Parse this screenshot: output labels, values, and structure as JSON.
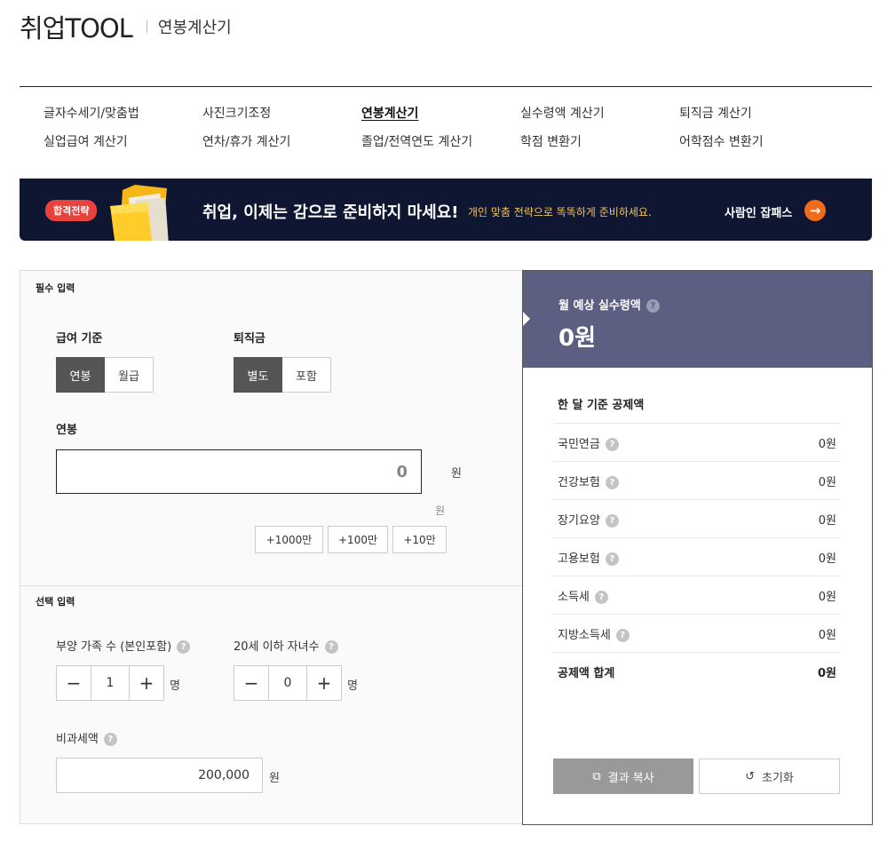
{
  "header": {
    "brand": "취업TOOL",
    "subtitle": "연봉계산기"
  },
  "nav": {
    "row1": [
      "글자수세기/맞춤법",
      "사진크기조정",
      "연봉계산기",
      "실수령액 계산기",
      "퇴직금 계산기"
    ],
    "row2": [
      "실업급여 계산기",
      "연차/휴가 계산기",
      "졸업/전역연도 계산기",
      "학점 변환기",
      "어학점수 변환기"
    ],
    "active": "연봉계산기"
  },
  "banner": {
    "badge": "합격전략",
    "main": "취업, 이제는 감으로 준비하지 마세요!",
    "desc": "개인 맞춤 전략으로 똑똑하게 준비하세요.",
    "cta": "사람인 잡패스",
    "cta_icon": "arrow-right-icon",
    "cta_color": "#f26b1d"
  },
  "required": {
    "title": "필수 입력",
    "pay_basis": {
      "label": "급여 기준",
      "options": [
        "연봉",
        "월급"
      ],
      "selected": "연봉"
    },
    "severance": {
      "label": "퇴직금",
      "options": [
        "별도",
        "포함"
      ],
      "selected": "별도"
    },
    "salary": {
      "label": "연봉",
      "value": "0",
      "unit": "원",
      "sub_unit": "원"
    },
    "add_buttons": [
      "+1000만",
      "+100만",
      "+10만"
    ]
  },
  "optional": {
    "title": "선택 입력",
    "dependents": {
      "label": "부양 가족 수 (본인포함)",
      "value": "1",
      "unit": "명",
      "minus": "−",
      "plus": "+"
    },
    "children": {
      "label": "20세 이하 자녀수",
      "value": "0",
      "unit": "명",
      "minus": "−",
      "plus": "+"
    },
    "nontax": {
      "label": "비과세액",
      "value": "200,000",
      "unit": "원"
    },
    "help": "?"
  },
  "result": {
    "label": "월 예상 실수령액",
    "amount": "0원",
    "deduction_title": "한 달 기준 공제액",
    "rows": [
      {
        "name": "국민연금",
        "value": "0원"
      },
      {
        "name": "건강보험",
        "value": "0원"
      },
      {
        "name": "장기요양",
        "value": "0원"
      },
      {
        "name": "고용보험",
        "value": "0원"
      },
      {
        "name": "소득세",
        "value": "0원"
      },
      {
        "name": "지방소득세",
        "value": "0원"
      }
    ],
    "total": {
      "name": "공제액 합계",
      "value": "0원"
    },
    "copy_button": "결과 복사",
    "reset_button": "초기화",
    "header_color": "#5c5f82"
  }
}
